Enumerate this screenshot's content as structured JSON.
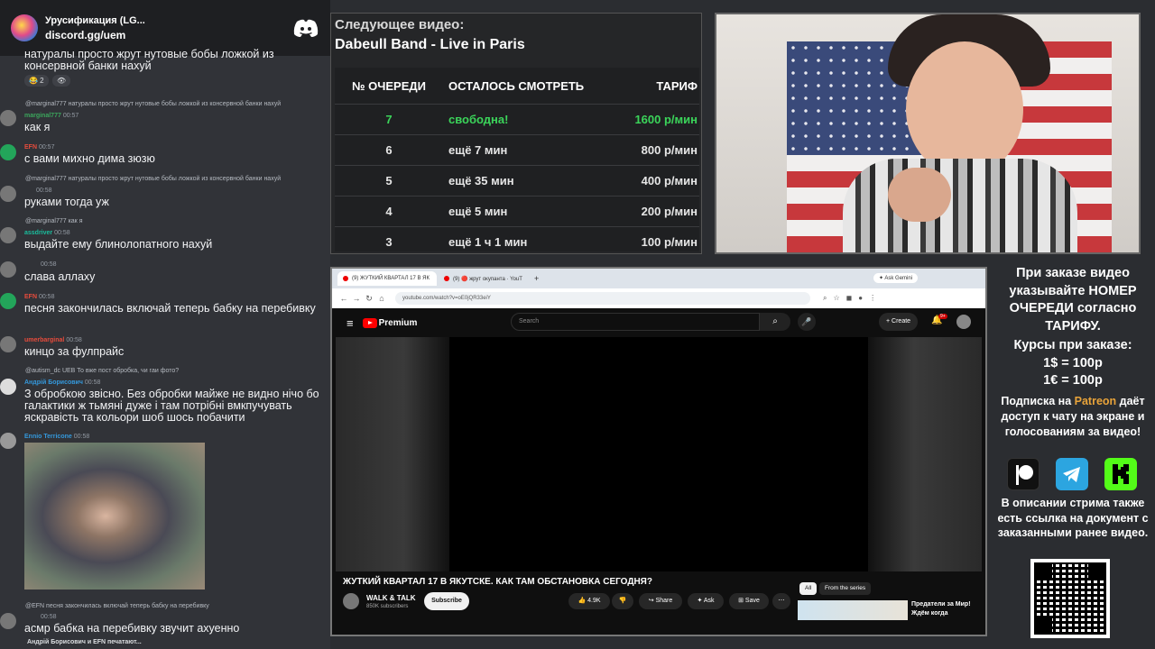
{
  "discord": {
    "server_name": "Урусификация (LG...",
    "invite": "discord.gg/uem",
    "typing": "Андрій Борисович и EFN печатают...",
    "messages": [
      {
        "text": "натуралы просто жрут нутовые бобы ложкой из консервной банки нахуй",
        "reactions": [
          "😂 2",
          "👁"
        ]
      },
      {
        "reply": "@marginal777 натуралы просто жрут нутовые бобы ложкой из консервной банки нахуй",
        "author": "marginal777",
        "time": "00:57",
        "text": "как я"
      },
      {
        "author": "EFN",
        "time": "00:57",
        "text": "с вами михно дима зюзю"
      },
      {
        "reply": "@marginal777 натуралы просто жрут нутовые бобы ложкой из консервной банки нахуй",
        "time": "00:58",
        "text": "руками тогда уж"
      },
      {
        "reply": "@marginal777 как я",
        "author": "assdriver",
        "time": "00:58",
        "text": "выдайте ему блинолопатного нахуй"
      },
      {
        "time": "00:58",
        "text": "слава аллаху"
      },
      {
        "author": "EFN",
        "time": "00:58",
        "text": "песня закончилась включай теперь бабку на перебивку"
      },
      {
        "author": "umerbarginal",
        "time": "00:58",
        "text": "кинцо за фулпрайс"
      },
      {
        "reply": "@autism_dc UEB То вже пост обробка, чи гаи фото?",
        "author": "Андрій Борисович",
        "time": "00:58",
        "text": "З обробкою звісно. Без обробки майже не видно нічо бо галактики ж тьмяні дуже і там потрібні вмкпучувать яскравість та кольори шоб шось побачити"
      },
      {
        "author": "Ennio Terricone",
        "time": "00:58"
      },
      {
        "reply": "@EFN песня закончилась включай теперь бабку на перебивку",
        "time": "00:58",
        "text": "асмр бабка на перебивку звучит ахуенно"
      }
    ]
  },
  "queue": {
    "next_label": "Следующее видео:",
    "next_title": "Dabeull Band - Live in Paris",
    "headers": [
      "№ ОЧЕРЕДИ",
      "ОСТАЛОСЬ СМОТРЕТЬ",
      "ТАРИФ"
    ],
    "rows": [
      {
        "num": "7",
        "remain": "свободна!",
        "tariff": "1600 р/мин",
        "free": true
      },
      {
        "num": "6",
        "remain": "ещё 7 мин",
        "tariff": "800 р/мин"
      },
      {
        "num": "5",
        "remain": "ещё 35 мин",
        "tariff": "400 р/мин"
      },
      {
        "num": "4",
        "remain": "ещё 5 мин",
        "tariff": "200 р/мин"
      },
      {
        "num": "3",
        "remain": "ещё 1 ч 1 мин",
        "tariff": "100 р/мин"
      }
    ]
  },
  "browser": {
    "tab1": "(9) ЖУТКИЙ КВАРТАЛ 17 В ЯК",
    "tab2": "(9) 🔴 жрут окупанта · YouT",
    "ask_gemini": "Ask Gemini",
    "url": "youtube.com/watch?v=oE0jQR33eiY",
    "yt_brand": "Premium",
    "search_placeholder": "Search",
    "create": "Create",
    "notif_count": "9+",
    "video_title": "ЖУТКИЙ КВАРТАЛ 17 В ЯКУТСКЕ. КАК ТАМ ОБСТАНОВКА СЕГОДНЯ?",
    "channel": "WALK & TALK",
    "subscribers": "850K subscribers",
    "subscribe": "Subscribe",
    "likes": "4.9K",
    "share": "Share",
    "ask": "Ask",
    "save": "Save",
    "chip_all": "All",
    "chip_series": "From the series",
    "rec_title": "Предатели за Мир! Ждём когда"
  },
  "info": {
    "main": "При заказе видео указывайте НОМЕР ОЧЕРЕДИ согласно ТАРИФУ.",
    "rates_label": "Курсы при заказе:",
    "rate1": "1$ = 100р",
    "rate2": "1€ = 100р",
    "patreon_pre": "Подписка на ",
    "patreon_word": "Patreon",
    "patreon_post": " даёт доступ к чату на экране и голосованиям за видео!",
    "desc": "В описании стрима также есть ссылка на документ с заказанными ранее видео.",
    "colors": {
      "patreon": "#e8a33a",
      "telegram": "#2ca5e0",
      "kick": "#53fc18",
      "free": "#3bd45a"
    }
  }
}
